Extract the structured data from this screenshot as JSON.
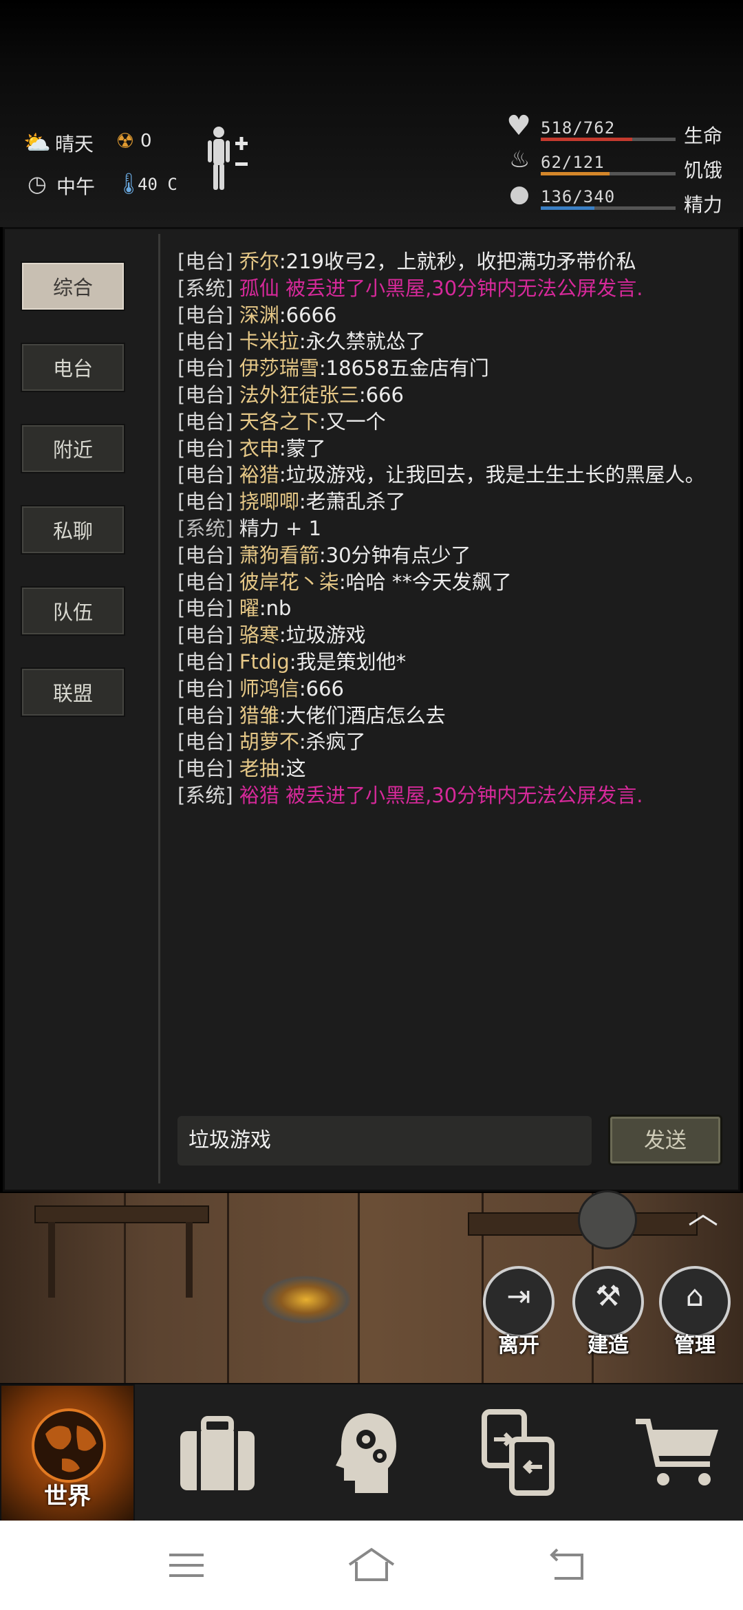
{
  "status": {
    "weather": "晴天",
    "radiation": "0",
    "time_of_day": "中午",
    "temperature": "40 C",
    "health": {
      "text": "518/762",
      "label": "生命",
      "fraction": 0.68,
      "color": "#c43a2e"
    },
    "hunger": {
      "text": "62/121",
      "label": "饥饿",
      "fraction": 0.51,
      "color": "#d4862a"
    },
    "energy": {
      "text": "136/340",
      "label": "精力",
      "fraction": 0.4,
      "color": "#3a7fc4"
    }
  },
  "tabs": [
    "综合",
    "电台",
    "附近",
    "私聊",
    "队伍",
    "联盟"
  ],
  "chat": [
    {
      "type": "radio",
      "tag": "[电台]",
      "who": "乔尔",
      "text": ":219收弓2，上就秒，收把满功矛带价私"
    },
    {
      "type": "ban",
      "tag": "[系统]",
      "who": "孤仙",
      "text": " 被丢进了小黑屋,30分钟内无法公屏发言."
    },
    {
      "type": "radio",
      "tag": "[电台]",
      "who": "深渊",
      "text": ":6666"
    },
    {
      "type": "radio",
      "tag": "[电台]",
      "who": "卡米拉",
      "text": ":永久禁就怂了"
    },
    {
      "type": "radio",
      "tag": "[电台]",
      "who": "伊莎瑞雪",
      "text": ":18658五金店有门"
    },
    {
      "type": "radio",
      "tag": "[电台]",
      "who": "法外狂徒张三",
      "text": ":666"
    },
    {
      "type": "radio",
      "tag": "[电台]",
      "who": "天各之下",
      "text": ":又一个"
    },
    {
      "type": "radio",
      "tag": "[电台]",
      "who": "衣申",
      "text": ":蒙了"
    },
    {
      "type": "radio",
      "tag": "[电台]",
      "who": "裕猎",
      "text": ":垃圾游戏，让我回去，我是土生土长的黑屋人。"
    },
    {
      "type": "radio",
      "tag": "[电台]",
      "who": "挠唧唧",
      "text": ":老萧乱杀了"
    },
    {
      "type": "sys",
      "tag": "[系统]",
      "who": "",
      "text": " 精力 + 1"
    },
    {
      "type": "radio",
      "tag": "[电台]",
      "who": "萧狗看箭",
      "text": ":30分钟有点少了"
    },
    {
      "type": "radio",
      "tag": "[电台]",
      "who": "彼岸花丶柒",
      "text": ":哈哈 **今天发飙了"
    },
    {
      "type": "radio",
      "tag": "[电台]",
      "who": "曜",
      "text": ":nb"
    },
    {
      "type": "radio",
      "tag": "[电台]",
      "who": "骆寒",
      "text": ":垃圾游戏"
    },
    {
      "type": "radio",
      "tag": "[电台]",
      "who": "Ftdig",
      "text": ":我是策划他*"
    },
    {
      "type": "radio",
      "tag": "[电台]",
      "who": "师鸿信",
      "text": ":666"
    },
    {
      "type": "radio",
      "tag": "[电台]",
      "who": "猎雏",
      "text": ":大佬们酒店怎么去"
    },
    {
      "type": "radio",
      "tag": "[电台]",
      "who": "胡萝不",
      "text": ":杀疯了"
    },
    {
      "type": "radio",
      "tag": "[电台]",
      "who": "老抽",
      "text": ":这"
    },
    {
      "type": "ban",
      "tag": "[系统]",
      "who": "裕猎",
      "text": " 被丢进了小黑屋,30分钟内无法公屏发言."
    }
  ],
  "input": {
    "value": "垃圾游戏"
  },
  "send_label": "发送",
  "actions": [
    "离开",
    "建造",
    "管理"
  ],
  "nav": {
    "world_label": "世界"
  }
}
